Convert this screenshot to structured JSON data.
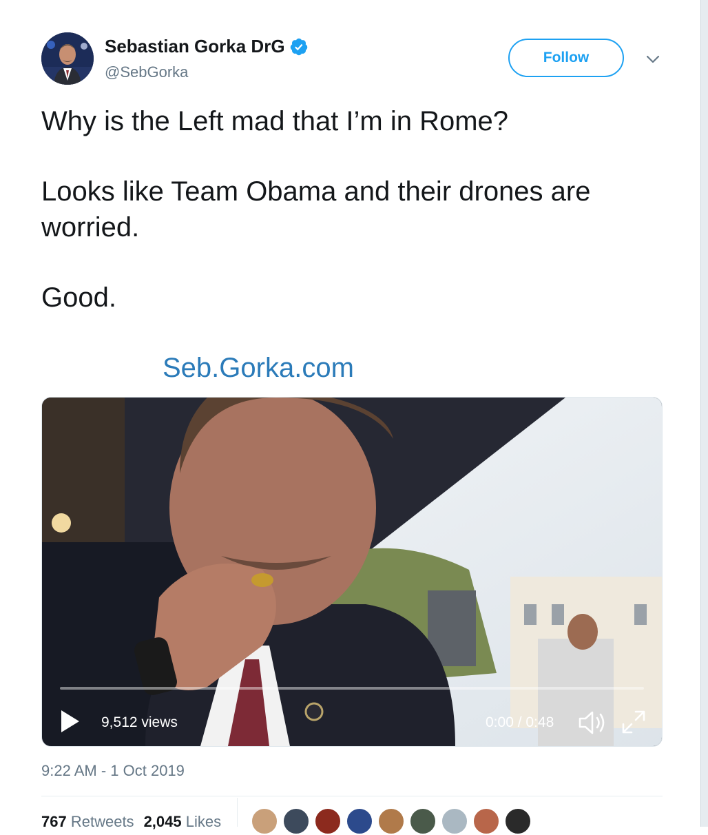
{
  "tweet": {
    "display_name": "Sebastian Gorka DrG",
    "handle": "@SebGorka",
    "verified": true,
    "follow_label": "Follow",
    "text_lines": [
      "Why is the Left mad that I’m in Rome?",
      "Looks like Team Obama and their drones are worried.",
      "Good."
    ],
    "link_text": "Seb.Gorka.com",
    "timestamp": "9:22 AM - 1 Oct 2019"
  },
  "video": {
    "views_label": "9,512 views",
    "time_label": "0:00 / 0:48",
    "progress_fraction": 0.0
  },
  "stats": {
    "retweets_count": "767",
    "retweets_label": "Retweets",
    "likes_count": "2,045",
    "likes_label": "Likes"
  },
  "colors": {
    "accent": "#1da1f2",
    "link": "#2b7bb9",
    "secondary_text": "#657786"
  },
  "icons": [
    "verified-badge-icon",
    "chevron-down-icon",
    "play-icon",
    "volume-icon",
    "fullscreen-icon"
  ]
}
